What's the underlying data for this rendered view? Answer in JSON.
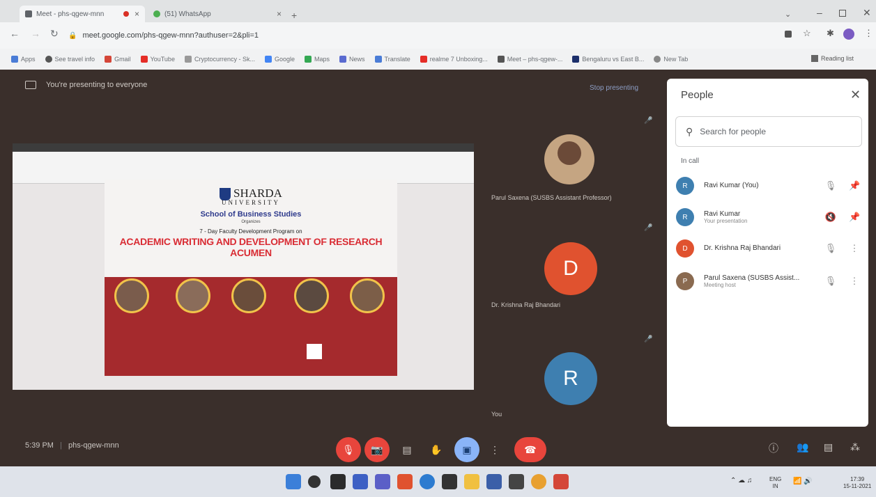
{
  "browser": {
    "tabs": [
      {
        "title": "Meet - phs-qgew-mnn",
        "active": true
      },
      {
        "title": "(51) WhatsApp",
        "active": false
      }
    ],
    "url": "meet.google.com/phs-qgew-mnn?authuser=2&pli=1",
    "bookmarks": [
      "Apps",
      "See travel info",
      "Gmail",
      "YouTube",
      "Cryptocurrency - Sk...",
      "Google",
      "Maps",
      "News",
      "Translate",
      "realme 7 Unboxing...",
      "Meet – phs-qgew-...",
      "Bengaluru vs East B...",
      "New Tab"
    ],
    "reading_list": "Reading list"
  },
  "meet": {
    "banner": "You're presenting to everyone",
    "stop_presenting": "Stop presenting",
    "slide": {
      "university": "SHARDA",
      "university_sub": "UNIVERSITY",
      "school": "School of Business Studies",
      "organizes": "Organizes",
      "program": "7 - Day Faculty Development Program on",
      "headline": "ACADEMIC WRITING AND DEVELOPMENT OF RESEARCH ACUMEN"
    },
    "tiles": [
      {
        "name": "Parul Saxena (SUSBS Assistant Professor)"
      },
      {
        "name": "Dr. Krishna Raj Bhandari",
        "initial": "D",
        "color": "#e0522f"
      },
      {
        "name": "You",
        "initial": "R",
        "color": "#3e7fb0"
      }
    ],
    "meeting_time": "5:39 PM",
    "meeting_code": "phs-qgew-mnn"
  },
  "people_panel": {
    "title": "People",
    "search_placeholder": "Search for people",
    "section": "In call",
    "participants": [
      {
        "name": "Ravi Kumar (You)",
        "sub": "",
        "initial": "R",
        "color": "#3e7fb0"
      },
      {
        "name": "Ravi Kumar",
        "sub": "Your presentation",
        "initial": "R",
        "color": "#3e7fb0"
      },
      {
        "name": "Dr. Krishna Raj Bhandari",
        "sub": "",
        "initial": "D",
        "color": "#e0522f"
      },
      {
        "name": "Parul Saxena (SUSBS Assist...",
        "sub": "Meeting host",
        "initial": "P",
        "color": "#8a6a50"
      }
    ]
  },
  "taskbar": {
    "lang_1": "ENG",
    "lang_2": "IN",
    "time": "17:39",
    "date": "15-11-2021"
  }
}
